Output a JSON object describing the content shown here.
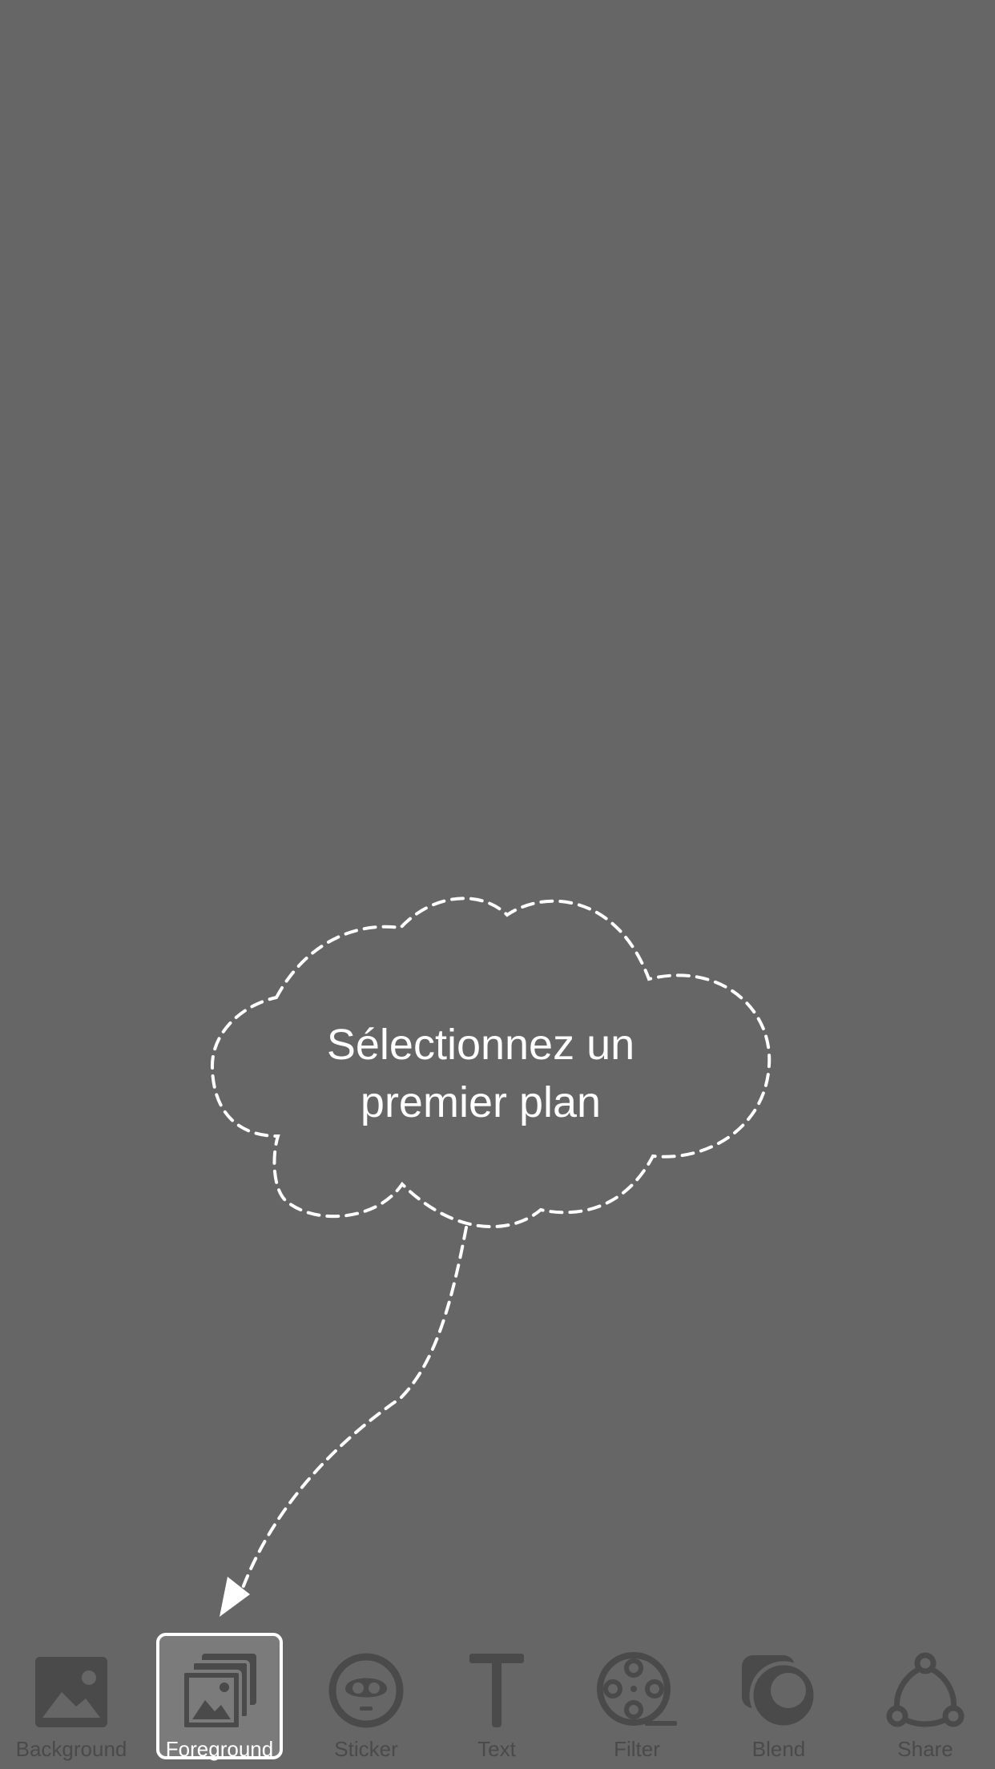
{
  "colors": {
    "background": "#666666",
    "icon": "#4a4a4a",
    "selected_fill": "#7b7b7b",
    "highlight": "#ffffff"
  },
  "tip": {
    "line1": "Sélectionnez un",
    "line2": "premier plan"
  },
  "toolbar": {
    "selected": "Foreground",
    "items": [
      {
        "label": "Background",
        "icon": "image-icon"
      },
      {
        "label": "Foreground",
        "icon": "layered-images-icon"
      },
      {
        "label": "Sticker",
        "icon": "sticker-face-icon"
      },
      {
        "label": "Text",
        "icon": "text-t-icon"
      },
      {
        "label": "Filter",
        "icon": "film-reel-icon"
      },
      {
        "label": "Blend",
        "icon": "blend-circles-icon"
      },
      {
        "label": "Share",
        "icon": "share-nodes-icon"
      }
    ]
  }
}
